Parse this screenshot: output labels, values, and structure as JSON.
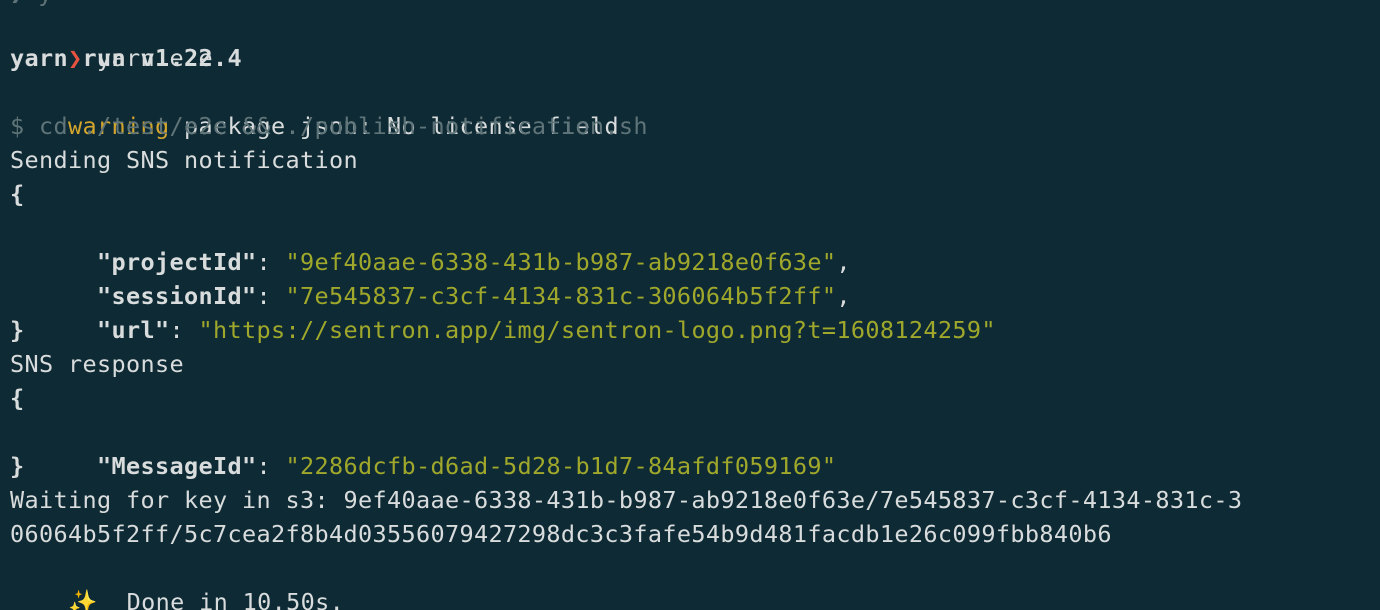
{
  "terminal": {
    "top_cut_text": "❯ y",
    "prompt_symbol": "❯",
    "command": " yarn e2e",
    "yarn_run": "yarn run v1.22.4",
    "warning_label": "warning",
    "warning_text": " package.json: No license field",
    "exec_line": "$ cd ./test/e2e && ./publish-notification.sh",
    "sending_text": "Sending SNS notification",
    "brace_open": "{",
    "brace_close": "}",
    "notification": {
      "indent": "  ",
      "project_key": "\"projectId\"",
      "project_value": "\"9ef40aae-6338-431b-b987-ab9218e0f63e\"",
      "session_key": "\"sessionId\"",
      "session_value": "\"7e545837-c3cf-4134-831c-306064b5f2ff\"",
      "url_key": "\"url\"",
      "url_value": "\"https://sentron.app/img/sentron-logo.png?t=1608124259\"",
      "colon": ": ",
      "comma": ","
    },
    "sns_response_text": "SNS response",
    "response": {
      "message_key": "\"MessageId\"",
      "message_value": "\"2286dcfb-d6ad-5d28-b1d7-84afdf059169\""
    },
    "waiting_line_1": "Waiting for key in s3: 9ef40aae-6338-431b-b987-ab9218e0f63e/7e545837-c3cf-4134-831c-3",
    "waiting_line_2": "06064b5f2ff/5c7cea2f8b4d03556079427298dc3c3fafe54b9d481facdb1e26c099fbb840b6",
    "done_icon": "✨",
    "done_text": "  Done in 10.50s."
  }
}
